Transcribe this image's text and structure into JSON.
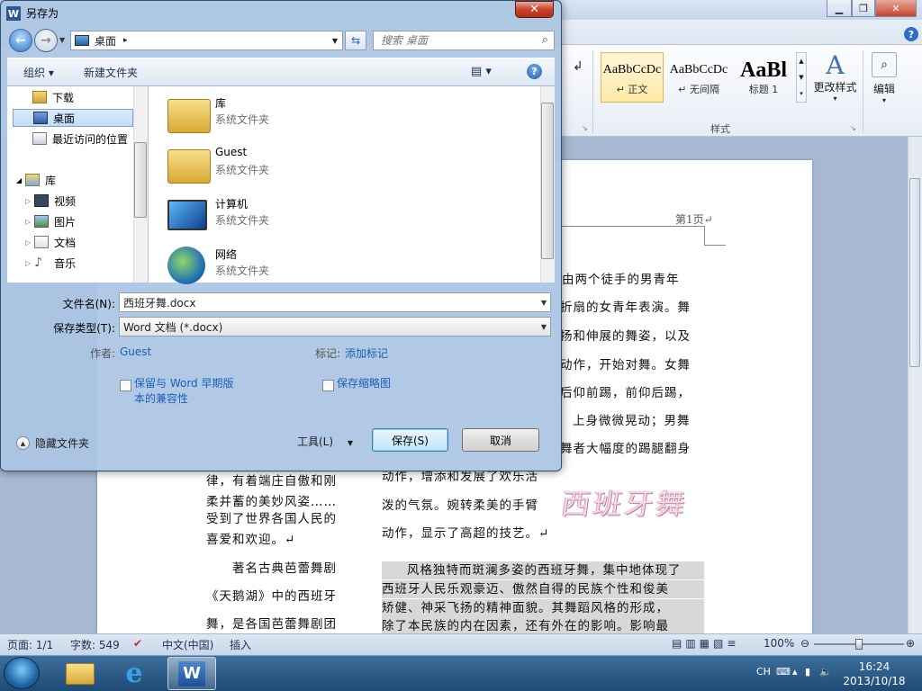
{
  "dialog": {
    "title": "另存为",
    "close_glyph": "✕",
    "address": {
      "location": "桌面",
      "separator": "▸"
    },
    "search": {
      "placeholder": "搜索 桌面"
    },
    "toolbar": {
      "organize": "组织 ▾",
      "new_folder": "新建文件夹",
      "help": "?"
    },
    "nav_items": [
      {
        "label": "下载",
        "icon": "downloads-folder-icon"
      },
      {
        "label": "桌面",
        "icon": "desktop-icon",
        "selected": true
      },
      {
        "label": "最近访问的位置",
        "icon": "recent-places-icon"
      },
      {
        "label": "库",
        "icon": "library-icon"
      },
      {
        "label": "视频",
        "icon": "videos-icon"
      },
      {
        "label": "图片",
        "icon": "pictures-icon"
      },
      {
        "label": "文档",
        "icon": "documents-icon"
      },
      {
        "label": "音乐",
        "icon": "music-icon"
      }
    ],
    "files": [
      {
        "name": "库",
        "type": "系统文件夹",
        "icon": "library-folder-icon"
      },
      {
        "name": "Guest",
        "type": "系统文件夹",
        "icon": "user-folder-icon"
      },
      {
        "name": "计算机",
        "type": "系统文件夹",
        "icon": "computer-icon"
      },
      {
        "name": "网络",
        "type": "系统文件夹",
        "icon": "network-icon"
      }
    ],
    "filename_label": "文件名(N):",
    "filename_value": "西班牙舞.docx",
    "filetype_label": "保存类型(T):",
    "filetype_value": "Word 文档 (*.docx)",
    "author_label": "作者:",
    "author_value": "Guest",
    "tags_label": "标记:",
    "tags_value": "添加标记",
    "compat_checkbox": "保留与 Word 早期版本的兼容性",
    "compat_line1": "保留与 Word 早期版",
    "compat_line2": "本的兼容性",
    "thumb_checkbox": "保存缩略图",
    "hide_folders": "隐藏文件夹",
    "tools": "工具(L)",
    "save": "保存(S)",
    "cancel": "取消"
  },
  "word": {
    "styles": [
      {
        "sample": "AaBbCcDc",
        "name": "↵ 正文"
      },
      {
        "sample": "AaBbCcDc",
        "name": "↵ 无间隔"
      },
      {
        "sample": "AaBl",
        "name": "标题 1"
      }
    ],
    "styles_group": "样式",
    "change_styles": "更改样式",
    "edit": "编辑",
    "page_header": "第1页↵",
    "right_col": [
      "由两个徒手的男青年",
      "折扇的女青年表演。舞",
      "扬和伸展的舞姿，以及",
      "动作，开始对舞。女舞",
      "后仰前踢，前仰后踢，",
      "上身微微晃动；男舞",
      "舞者大幅度的踢腿翻身",
      "动作，增添和发展了欢乐活",
      "泼的气氛。婉转柔美的手臂",
      "动作，显示了高超的技艺。↵"
    ],
    "left_col": [
      "律，有着端庄自傲和刚",
      "柔并蓄的美妙风姿……",
      "受到了世界各国人民的",
      "喜爱和欢迎。↵",
      "著名古典芭蕾舞剧",
      "《天鹅湖》中的西班牙",
      "舞，是各国芭蕾舞剧团"
    ],
    "shaded_para": [
      "风格独特而斑澜多姿的西班牙舞，集中地体现了",
      "西班牙人民乐观豪迈、傲然自得的民族个性和俊美",
      "矫健、神采飞扬的精神面貌。其舞蹈风格的形成，",
      "除了本民族的内在因素，还有外在的影响。影响最"
    ],
    "wordart": "西班牙舞",
    "status": {
      "page": "页面: 1/1",
      "words": "字数: 549",
      "lang": "中文(中国)",
      "mode": "插入",
      "zoom": "100%"
    }
  },
  "taskbar": {
    "lang": "CH",
    "time": "16:24",
    "date": "2013/10/18"
  }
}
